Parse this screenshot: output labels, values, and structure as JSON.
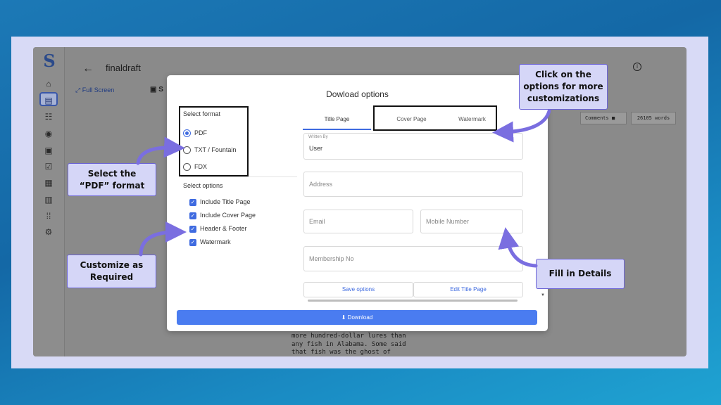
{
  "app": {
    "logo": "S",
    "title": "finaldraft",
    "back_icon": "←",
    "info_icon": "i",
    "fullscreen_label": "Full Screen",
    "sub_toolbar_label": "S",
    "comments_label": "Comments",
    "comments_icon": "■",
    "word_count": "26105 words",
    "script_lines": [
      "more hundred-dollar lures than",
      "any fish in Alabama. Some said",
      "that fish was the ghost of"
    ]
  },
  "sidebar": {
    "icons": [
      "home-icon",
      "script-icon",
      "notes-icon",
      "target-icon",
      "calendar-icon",
      "document-check-icon",
      "contacts-icon",
      "chart-icon",
      "grid-icon",
      "settings-icon"
    ],
    "glyphs": [
      "⌂",
      "▤",
      "☷",
      "◉",
      "▣",
      "☑",
      "▦",
      "▥",
      "⁞⁞",
      "⚙"
    ]
  },
  "modal": {
    "title": "Dowload options",
    "select_format_label": "Select format",
    "formats": [
      {
        "label": "PDF",
        "checked": true
      },
      {
        "label": "TXT / Fountain",
        "checked": false
      },
      {
        "label": "FDX",
        "checked": false
      }
    ],
    "select_options_label": "Select options",
    "options": [
      {
        "label": "Include Title Page",
        "checked": true
      },
      {
        "label": "Include Cover Page",
        "checked": true
      },
      {
        "label": "Header & Footer",
        "checked": true
      },
      {
        "label": "Watermark",
        "checked": true
      }
    ],
    "tabs": [
      "Title Page",
      "Cover Page",
      "Watermark"
    ],
    "active_tab": "Title Page",
    "fields": {
      "written_by_label": "Written By",
      "written_by_value": "User",
      "address": "Address",
      "email": "Email",
      "mobile": "Mobile Number",
      "membership": "Membership No"
    },
    "save_options": "Save options",
    "edit_title_page": "Edit Title Page",
    "download": "Download",
    "download_icon": "⬇"
  },
  "callouts": {
    "select_pdf": [
      "Select the",
      "“PDF” format"
    ],
    "customize": [
      "Customize as",
      "Required"
    ],
    "click_options": [
      "Click on the",
      "options for more",
      "customizations"
    ],
    "fill_details": [
      "Fill in Details"
    ]
  },
  "colors": {
    "accent": "#4a7cf0",
    "callout_bg": "#d5d6f7",
    "callout_border": "#6b63d6",
    "arrow": "#7a6ee0"
  }
}
